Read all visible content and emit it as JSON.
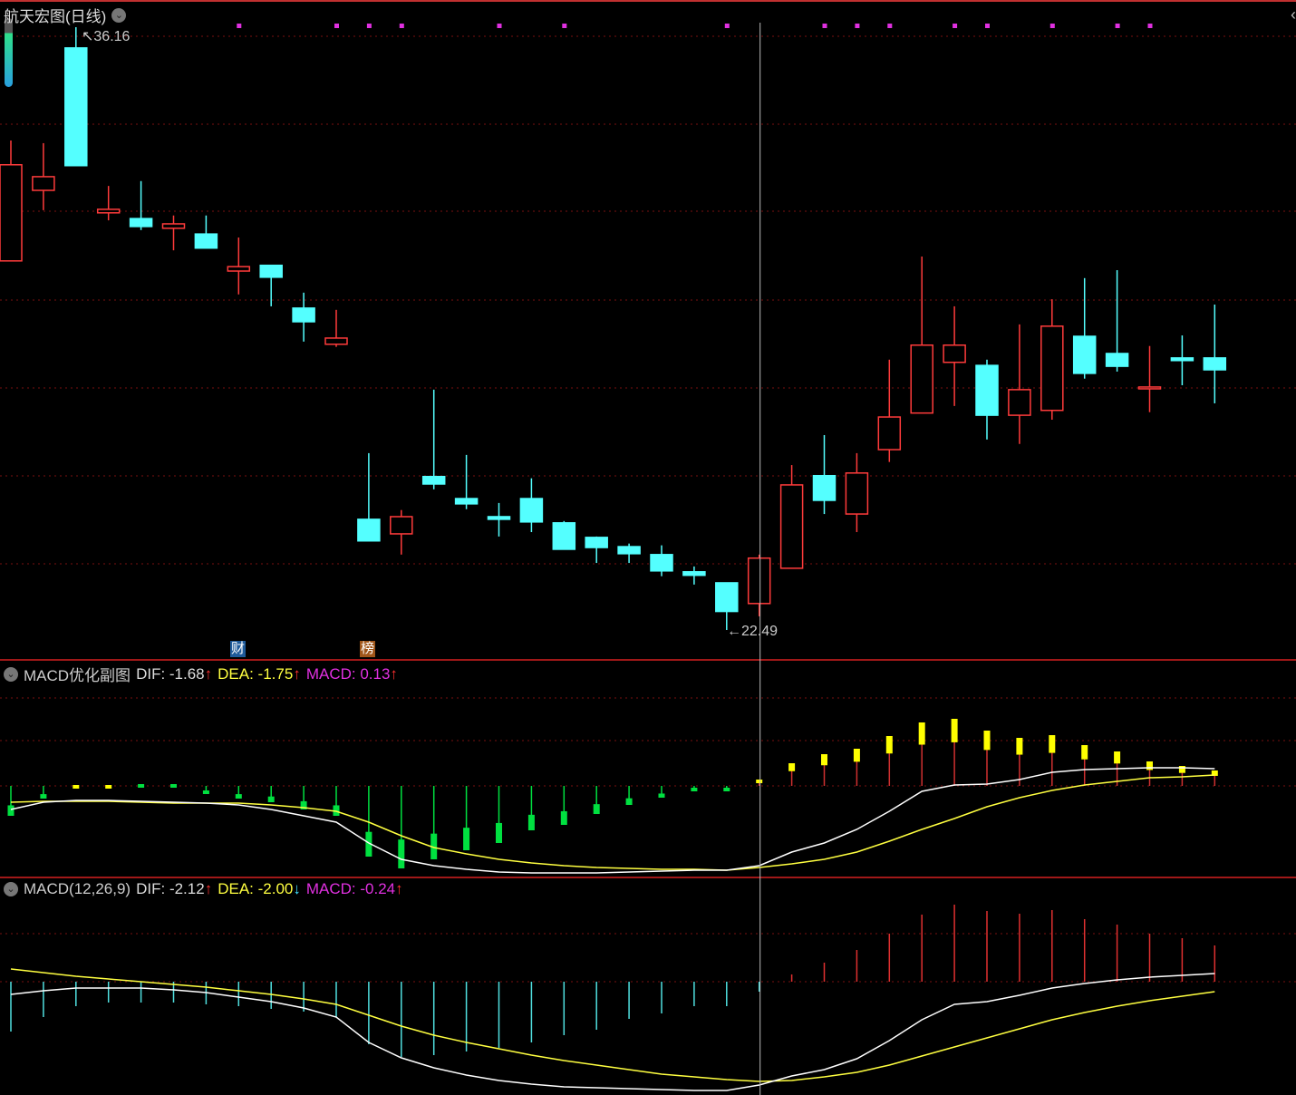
{
  "title": "航天宏图(日线)",
  "price_high_label": "36.16",
  "price_low_label": "22.49",
  "markers": [
    {
      "text": "财",
      "index": 7,
      "color": "#1e5a9a"
    },
    {
      "text": "榜",
      "index": 11,
      "color": "#a0561a"
    }
  ],
  "event_dot_indices": [
    7,
    10,
    11,
    12,
    15,
    17,
    22,
    25,
    26,
    27,
    29,
    30,
    32,
    34,
    35
  ],
  "crosshair_index": 23,
  "colors": {
    "up": "#ff3b3b",
    "down": "#54ffff",
    "dif": "#ffffff",
    "dea": "#ffff40",
    "macd": "#ff40ff",
    "grid": "#7a1010",
    "hist_pos": "#ffff00",
    "hist_neg": "#00e040",
    "hist2_pos": "#e03030",
    "hist2_neg": "#50e0e0"
  },
  "chart_data": {
    "type": "candlestick",
    "price_range": [
      22.49,
      36.16
    ],
    "candles": [
      [
        30.86,
        33.59,
        30.86,
        33.04
      ],
      [
        32.46,
        33.53,
        32.01,
        32.77
      ],
      [
        35.69,
        36.16,
        33.02,
        33.02
      ],
      [
        31.95,
        32.56,
        31.78,
        32.03
      ],
      [
        31.82,
        32.67,
        31.56,
        31.64
      ],
      [
        31.6,
        31.89,
        31.1,
        31.7
      ],
      [
        31.47,
        31.89,
        31.15,
        31.15
      ],
      [
        30.63,
        31.39,
        30.1,
        30.73
      ],
      [
        30.76,
        30.76,
        29.83,
        30.49
      ],
      [
        29.79,
        30.14,
        29.03,
        29.48
      ],
      [
        28.97,
        29.75,
        28.91,
        29.11
      ],
      [
        25.0,
        26.5,
        24.51,
        24.51
      ],
      [
        24.67,
        25.21,
        24.2,
        25.06
      ],
      [
        25.97,
        27.94,
        25.68,
        25.8
      ],
      [
        25.47,
        26.46,
        25.23,
        25.35
      ],
      [
        25.06,
        25.37,
        24.61,
        25.0
      ],
      [
        25.47,
        25.93,
        24.71,
        24.94
      ],
      [
        24.92,
        24.96,
        24.32,
        24.32
      ],
      [
        24.59,
        24.61,
        24.01,
        24.36
      ],
      [
        24.38,
        24.45,
        24.01,
        24.22
      ],
      [
        24.2,
        24.41,
        23.71,
        23.83
      ],
      [
        23.81,
        23.93,
        23.52,
        23.73
      ],
      [
        23.56,
        23.56,
        22.49,
        22.91
      ],
      [
        23.09,
        24.2,
        22.8,
        24.12
      ],
      [
        23.89,
        26.23,
        23.89,
        25.78
      ],
      [
        25.99,
        26.91,
        25.12,
        25.43
      ],
      [
        25.12,
        26.5,
        24.71,
        26.05
      ],
      [
        26.58,
        28.62,
        26.3,
        27.32
      ],
      [
        27.41,
        30.96,
        27.41,
        28.95
      ],
      [
        28.56,
        29.83,
        27.57,
        28.95
      ],
      [
        28.49,
        28.62,
        26.81,
        27.36
      ],
      [
        27.36,
        29.42,
        26.71,
        27.94
      ],
      [
        27.47,
        29.99,
        27.26,
        29.38
      ],
      [
        29.15,
        30.47,
        28.19,
        28.31
      ],
      [
        28.76,
        30.65,
        28.35,
        28.47
      ],
      [
        27.96,
        28.93,
        27.43,
        28.0
      ],
      [
        28.66,
        29.17,
        28.04,
        28.6
      ],
      [
        28.66,
        29.87,
        27.63,
        28.39
      ]
    ],
    "sub1": {
      "name": "MACD优化副图",
      "hist_baseline": -1.87,
      "dif": [
        -2.13,
        -2.05,
        -2.03,
        -2.03,
        -2.04,
        -2.05,
        -2.06,
        -2.08,
        -2.13,
        -2.2,
        -2.27,
        -2.5,
        -2.68,
        -2.75,
        -2.79,
        -2.82,
        -2.83,
        -2.83,
        -2.83,
        -2.82,
        -2.81,
        -2.8,
        -2.8,
        -2.75,
        -2.6,
        -2.5,
        -2.35,
        -2.15,
        -1.93,
        -1.86,
        -1.85,
        -1.8,
        -1.72,
        -1.69,
        -1.68,
        -1.67,
        -1.67,
        -1.68
      ],
      "dea": [
        -2.05,
        -2.04,
        -2.04,
        -2.04,
        -2.05,
        -2.06,
        -2.06,
        -2.06,
        -2.08,
        -2.11,
        -2.15,
        -2.27,
        -2.42,
        -2.55,
        -2.62,
        -2.68,
        -2.72,
        -2.75,
        -2.77,
        -2.78,
        -2.79,
        -2.79,
        -2.8,
        -2.77,
        -2.73,
        -2.68,
        -2.6,
        -2.48,
        -2.35,
        -2.23,
        -2.1,
        -2.0,
        -1.92,
        -1.86,
        -1.82,
        -1.78,
        -1.77,
        -1.75
      ],
      "macd": [
        -0.33,
        -0.14,
        0.01,
        0.01,
        -0.02,
        -0.02,
        -0.09,
        -0.14,
        -0.18,
        -0.26,
        -0.33,
        -0.78,
        -0.91,
        -0.81,
        -0.71,
        -0.63,
        -0.49,
        -0.43,
        -0.31,
        -0.21,
        -0.13,
        -0.06,
        -0.06,
        0.07,
        0.25,
        0.35,
        0.41,
        0.55,
        0.7,
        0.74,
        0.61,
        0.53,
        0.56,
        0.45,
        0.38,
        0.27,
        0.22,
        0.17
      ]
    },
    "sub2": {
      "name": "MACD(12,26,9)",
      "dif": [
        -0.14,
        -0.1,
        -0.07,
        -0.07,
        -0.07,
        -0.09,
        -0.12,
        -0.17,
        -0.22,
        -0.29,
        -0.39,
        -0.67,
        -0.84,
        -0.95,
        -1.03,
        -1.09,
        -1.13,
        -1.16,
        -1.17,
        -1.18,
        -1.19,
        -1.2,
        -1.2,
        -1.14,
        -1.04,
        -0.97,
        -0.85,
        -0.65,
        -0.42,
        -0.25,
        -0.22,
        -0.15,
        -0.07,
        -0.02,
        0.02,
        0.05,
        0.07,
        0.09
      ],
      "dea": [
        0.14,
        0.1,
        0.06,
        0.03,
        0.0,
        -0.03,
        -0.06,
        -0.1,
        -0.14,
        -0.19,
        -0.25,
        -0.37,
        -0.49,
        -0.59,
        -0.67,
        -0.74,
        -0.81,
        -0.87,
        -0.92,
        -0.97,
        -1.02,
        -1.05,
        -1.08,
        -1.1,
        -1.09,
        -1.05,
        -1.0,
        -0.92,
        -0.82,
        -0.72,
        -0.62,
        -0.52,
        -0.42,
        -0.34,
        -0.27,
        -0.21,
        -0.16,
        -0.11
      ],
      "macd": [
        -0.55,
        -0.39,
        -0.27,
        -0.23,
        -0.23,
        -0.23,
        -0.25,
        -0.27,
        -0.3,
        -0.33,
        -0.39,
        -0.69,
        -0.83,
        -0.81,
        -0.77,
        -0.73,
        -0.67,
        -0.59,
        -0.53,
        -0.41,
        -0.35,
        -0.27,
        -0.27,
        -0.11,
        0.08,
        0.21,
        0.35,
        0.53,
        0.74,
        0.85,
        0.78,
        0.75,
        0.79,
        0.69,
        0.63,
        0.53,
        0.48,
        0.4
      ]
    }
  },
  "sub1_header": {
    "name": "MACD优化副图",
    "dif": "DIF: -1.68",
    "dea": "DEA: -1.75",
    "macd": "MACD: 0.13",
    "dif_arrow": "↑",
    "dea_arrow": "↑",
    "macd_arrow": "↑"
  },
  "sub2_header": {
    "name": "MACD(12,26,9)",
    "dif": "DIF: -2.12",
    "dea": "DEA: -2.00",
    "macd": "MACD: -0.24",
    "dif_arrow": "↑",
    "dea_arrow": "↓",
    "macd_arrow": "↑"
  },
  "icons": {
    "dropdown": "⌄",
    "collapse": "‹"
  }
}
